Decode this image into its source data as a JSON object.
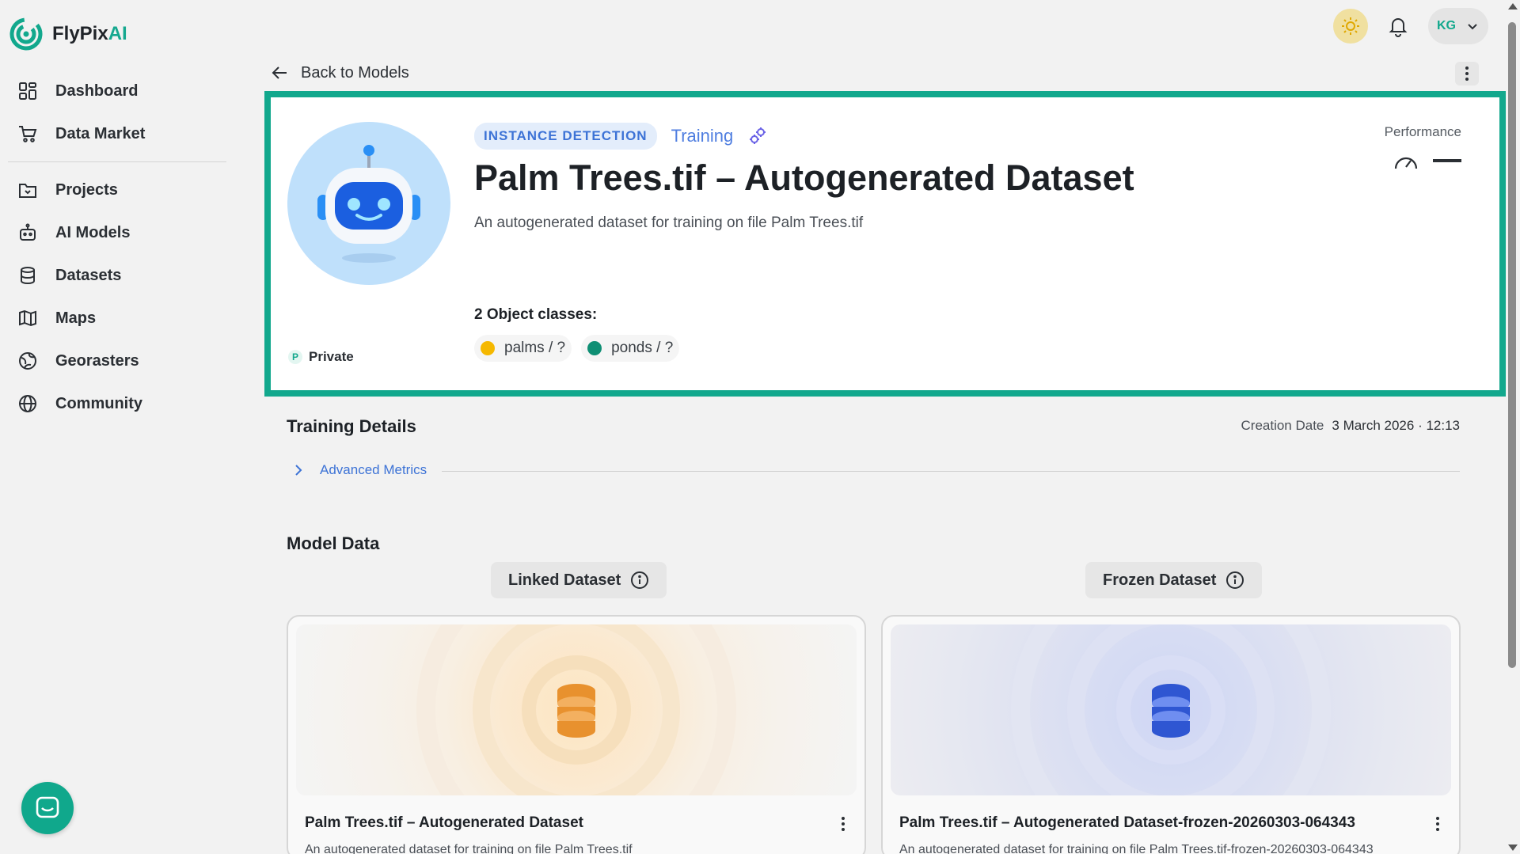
{
  "app": {
    "name_main": "FlyPix",
    "name_accent": "AI"
  },
  "sidebar": {
    "items": [
      {
        "label": "Dashboard",
        "icon": "dashboard-icon"
      },
      {
        "label": "Data Market",
        "icon": "cart-icon"
      },
      {
        "label": "Projects",
        "icon": "folder-icon"
      },
      {
        "label": "AI Models",
        "icon": "robot-icon"
      },
      {
        "label": "Datasets",
        "icon": "database-icon"
      },
      {
        "label": "Maps",
        "icon": "map-icon"
      },
      {
        "label": "Georasters",
        "icon": "globe-grid-icon"
      },
      {
        "label": "Community",
        "icon": "globe-icon"
      }
    ]
  },
  "topbar": {
    "user_initials": "KG"
  },
  "nav": {
    "back_label": "Back to Models"
  },
  "model": {
    "type_badge": "INSTANCE DETECTION",
    "status": "Training",
    "title": "Palm Trees.tif – Autogenerated Dataset",
    "description": "An autogenerated dataset for training on file Palm Trees.tif",
    "visibility_letter": "P",
    "visibility": "Private",
    "performance_label": "Performance",
    "classes_label": "2 Object classes:",
    "classes": [
      {
        "label": "palms / ?",
        "color": "#f5b800"
      },
      {
        "label": "ponds / ?",
        "color": "#0f8f74"
      }
    ]
  },
  "training": {
    "title": "Training Details",
    "creation_label": "Creation Date",
    "creation_value": "3 March 2026 · 12:13",
    "advanced_label": "Advanced Metrics"
  },
  "model_data": {
    "title": "Model Data",
    "linked_tab": "Linked Dataset",
    "frozen_tab": "Frozen Dataset",
    "linked_card": {
      "title": "Palm Trees.tif – Autogenerated Dataset",
      "description": "An autogenerated dataset for training on file Palm Trees.tif"
    },
    "frozen_card": {
      "title": "Palm Trees.tif – Autogenerated Dataset-frozen-20260303-064343",
      "description": "An autogenerated dataset for training on file Palm Trees.tif-frozen-20260303-064343"
    }
  },
  "colors": {
    "accent": "#12a88d",
    "link": "#3d73d6"
  }
}
